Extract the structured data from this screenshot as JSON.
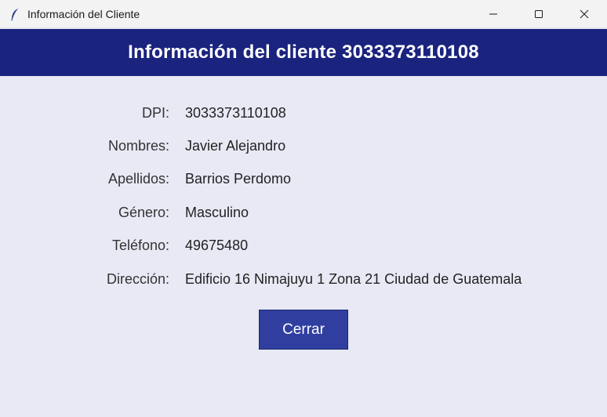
{
  "window": {
    "title": "Información del Cliente",
    "icon": "feather-icon"
  },
  "header": {
    "title": "Información del cliente 3033373110108"
  },
  "fields": [
    {
      "label": "DPI:",
      "value": "3033373110108"
    },
    {
      "label": "Nombres:",
      "value": "Javier Alejandro"
    },
    {
      "label": "Apellidos:",
      "value": "Barrios Perdomo"
    },
    {
      "label": "Género:",
      "value": "Masculino"
    },
    {
      "label": "Teléfono:",
      "value": "49675480"
    },
    {
      "label": "Dirección:",
      "value": "Edificio 16 Nimajuyu 1 Zona 21 Ciudad de Guatemala"
    }
  ],
  "actions": {
    "close_label": "Cerrar"
  },
  "colors": {
    "header_bg": "#1a237e",
    "body_bg": "#e8e9f5",
    "button_bg": "#303f9f"
  }
}
